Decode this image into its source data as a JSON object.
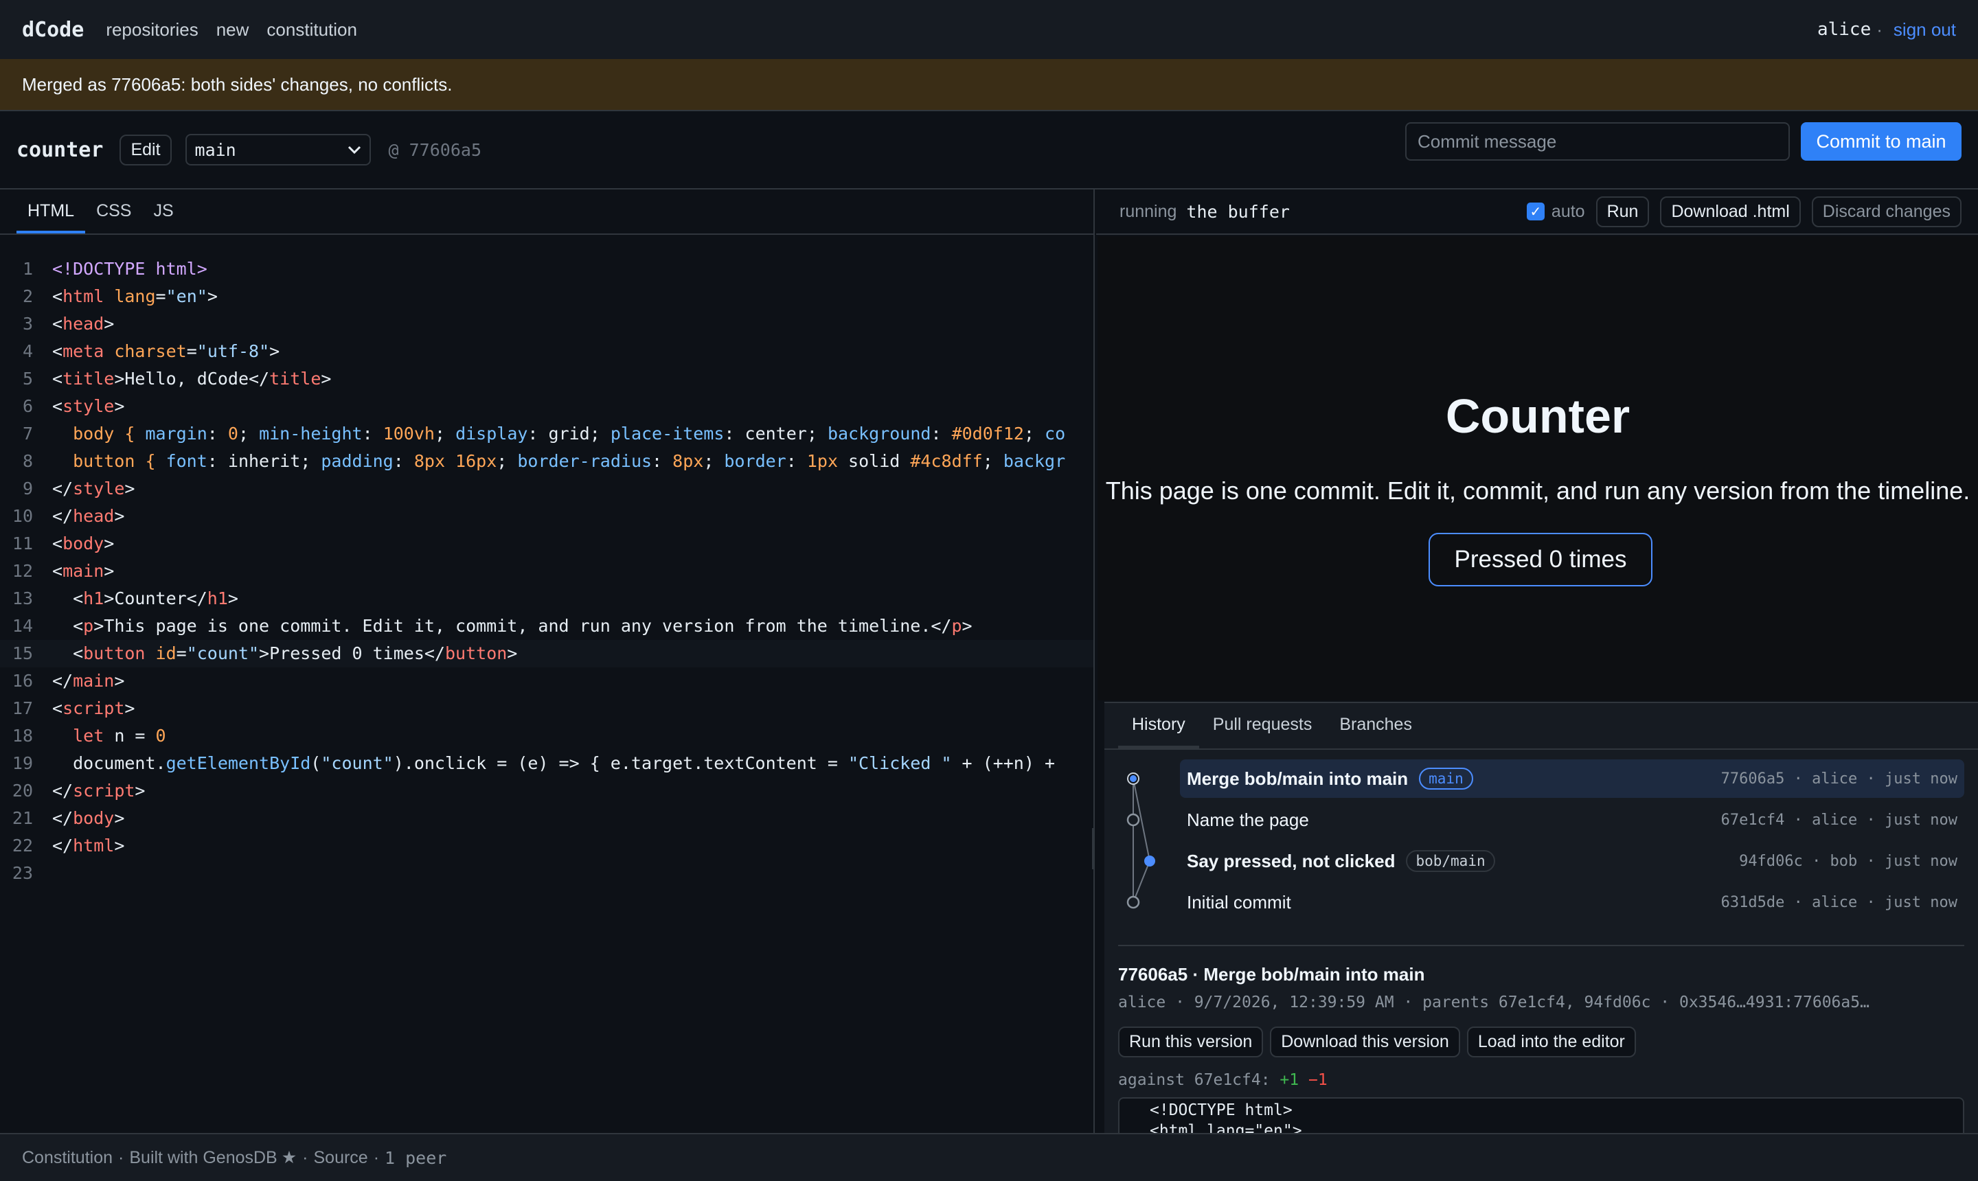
{
  "nav": {
    "brand": "dCode",
    "links": [
      "repositories",
      "new",
      "constitution"
    ],
    "user": "alice",
    "separator": "·",
    "signout": "sign out"
  },
  "banner": {
    "text": "Merged as 77606a5: both sides' changes, no conflicts."
  },
  "repo": {
    "name": "counter",
    "edit_label": "Edit",
    "branch": "main",
    "at_sha": "@ 77606a5",
    "commit_placeholder": "Commit message",
    "commit_button": "Commit to main"
  },
  "editor": {
    "tabs": [
      "HTML",
      "CSS",
      "JS"
    ],
    "active_tab": "HTML",
    "line_numbers": [
      "1",
      "2",
      "3",
      "4",
      "5",
      "6",
      "7",
      "8",
      "9",
      "10",
      "11",
      "12",
      "13",
      "14",
      "15",
      "16",
      "17",
      "18",
      "19",
      "20",
      "21",
      "22",
      "23"
    ],
    "lines": {
      "l1a": "<!DOCTYPE html>",
      "l2a": "<",
      "l2b": "html",
      "l2c": " lang",
      "l2d": "=",
      "l2e": "\"en\"",
      "l2f": ">",
      "l3a": "<",
      "l3b": "head",
      "l3c": ">",
      "l4a": "<",
      "l4b": "meta",
      "l4c": " charset",
      "l4d": "=",
      "l4e": "\"utf-8\"",
      "l4f": ">",
      "l5a": "<",
      "l5b": "title",
      "l5c": ">Hello, dCode</",
      "l5d": "title",
      "l5e": ">",
      "l6a": "<",
      "l6b": "style",
      "l6c": ">",
      "l7a": "  body { ",
      "l7b": "margin",
      "l7c": ": ",
      "l7d": "0",
      "l7e": "; ",
      "l7f": "min-height",
      "l7g": ": ",
      "l7h": "100vh",
      "l7i": "; ",
      "l7j": "display",
      "l7k": ": grid; ",
      "l7l": "place-items",
      "l7m": ": center; ",
      "l7n": "background",
      "l7o": ": ",
      "l7p": "#0d0f12",
      "l7q": "; ",
      "l7r": "co",
      "l8a": "  button { ",
      "l8b": "font",
      "l8c": ": inherit; ",
      "l8d": "padding",
      "l8e": ": ",
      "l8f": "8px 16px",
      "l8g": "; ",
      "l8h": "border-radius",
      "l8i": ": ",
      "l8j": "8px",
      "l8k": "; ",
      "l8l": "border",
      "l8m": ": ",
      "l8n": "1px",
      "l8o": " solid ",
      "l8p": "#4c8dff",
      "l8q": "; ",
      "l8r": "backgr",
      "l9a": "</",
      "l9b": "style",
      "l9c": ">",
      "l10a": "</",
      "l10b": "head",
      "l10c": ">",
      "l11a": "<",
      "l11b": "body",
      "l11c": ">",
      "l12a": "<",
      "l12b": "main",
      "l12c": ">",
      "l13a": "  <",
      "l13b": "h1",
      "l13c": ">Counter</",
      "l13d": "h1",
      "l13e": ">",
      "l14a": "  <",
      "l14b": "p",
      "l14c": ">This page is one commit. Edit it, commit, and run any version from the timeline.</",
      "l14d": "p",
      "l14e": ">",
      "l15a": "  <",
      "l15b": "button",
      "l15c": " id",
      "l15d": "=",
      "l15e": "\"count\"",
      "l15f": ">Pressed 0 times</",
      "l15g": "button",
      "l15h": ">",
      "l16a": "</",
      "l16b": "main",
      "l16c": ">",
      "l17a": "<",
      "l17b": "script",
      "l17c": ">",
      "l18a": "  ",
      "l18b": "let",
      "l18c": " n = ",
      "l18d": "0",
      "l19a": "  document.",
      "l19b": "getElementById",
      "l19c": "(",
      "l19d": "\"count\"",
      "l19e": ").onclick = (e) => { e.target.textContent = ",
      "l19f": "\"Clicked \"",
      "l19g": " + (++n) +",
      "l20a": "</",
      "l20b": "script",
      "l20c": ">",
      "l21a": "</",
      "l21b": "body",
      "l21c": ">",
      "l22a": "</",
      "l22b": "html",
      "l22c": ">"
    }
  },
  "runbar": {
    "label": "running",
    "target": "the buffer",
    "auto_label": "auto",
    "auto_checked": "✓",
    "run": "Run",
    "download": "Download .html",
    "discard": "Discard changes"
  },
  "preview": {
    "title": "Counter",
    "text": "This page is one commit. Edit it, commit, and run any version from the timeline.",
    "button": "Pressed 0 times"
  },
  "history": {
    "tabs": [
      "History",
      "Pull requests",
      "Branches"
    ],
    "active_tab": "History",
    "commits": [
      {
        "message": "Merge bob/main into main",
        "tag": "main",
        "meta": "77606a5 · alice · just now",
        "bold": true,
        "selected": true
      },
      {
        "message": "Name the page",
        "tag": "",
        "meta": "67e1cf4 · alice · just now",
        "bold": false
      },
      {
        "message": "Say pressed, not clicked",
        "tag": "bob/main",
        "meta": "94fd06c · bob · just now",
        "bold": true
      },
      {
        "message": "Initial commit",
        "tag": "",
        "meta": "631d5de · alice · just now",
        "bold": false
      }
    ],
    "detail": {
      "title": "77606a5 · Merge bob/main into main",
      "meta": "alice · 9/7/2026, 12:39:59 AM · parents 67e1cf4, 94fd06c · 0x3546…4931:77606a5…",
      "actions": [
        "Run this version",
        "Download this version",
        "Load into the editor"
      ],
      "against": "against 67e1cf4:",
      "plus": "+1",
      "minus": "−1",
      "diff_lines": [
        "<!DOCTYPE html>",
        "<html lang=\"en\">"
      ]
    },
    "colors": {
      "accent": "#2f81f7",
      "selected_bg": "#1d2a40",
      "graph_line": "#6e7681"
    }
  },
  "footer": {
    "constitution": "Constitution",
    "built": "Built with GenosDB",
    "star": "★",
    "source": "Source",
    "peers": "1 peer"
  }
}
